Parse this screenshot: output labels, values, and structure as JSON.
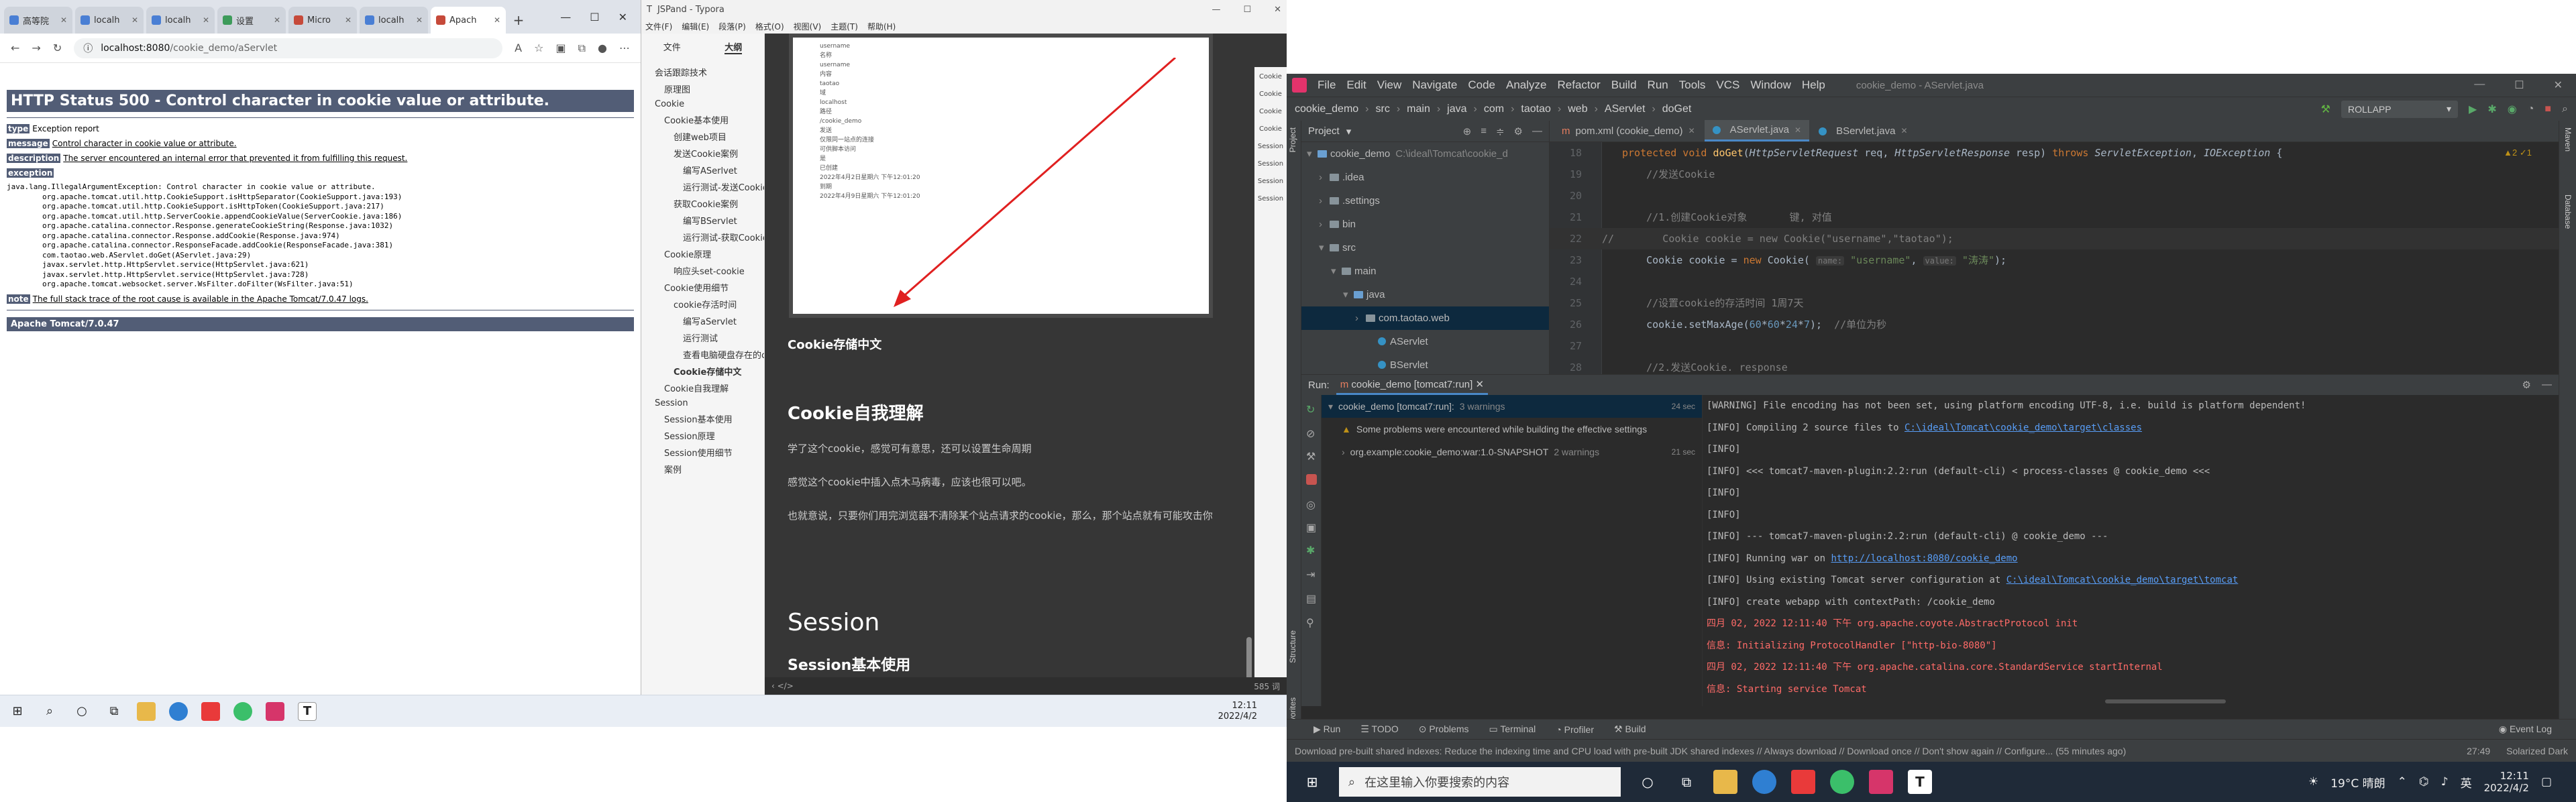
{
  "browser": {
    "tabs": [
      {
        "label": "高等院"
      },
      {
        "label": "localh"
      },
      {
        "label": "localh"
      },
      {
        "label": "设置"
      },
      {
        "label": "Micro"
      },
      {
        "label": "localh"
      },
      {
        "label": "Apach"
      }
    ],
    "url_host": "localhost:8080",
    "url_path": "/cookie_demo/aServlet",
    "page": {
      "title": "HTTP Status 500 - Control character in cookie value or attribute.",
      "type_label": "type",
      "type_value": "Exception report",
      "message_label": "message",
      "message_value": "Control character in cookie value or attribute.",
      "description_label": "description",
      "description_value": "The server encountered an internal error that prevented it from fulfilling this request.",
      "exception_label": "exception",
      "stacktrace": "java.lang.IllegalArgumentException: Control character in cookie value or attribute.\n\torg.apache.tomcat.util.http.CookieSupport.isHttpSeparator(CookieSupport.java:193)\n\torg.apache.tomcat.util.http.CookieSupport.isHttpToken(CookieSupport.java:217)\n\torg.apache.tomcat.util.http.ServerCookie.appendCookieValue(ServerCookie.java:186)\n\torg.apache.catalina.connector.Response.generateCookieString(Response.java:1032)\n\torg.apache.catalina.connector.Response.addCookie(Response.java:974)\n\torg.apache.catalina.connector.ResponseFacade.addCookie(ResponseFacade.java:381)\n\tcom.taotao.web.AServlet.doGet(AServlet.java:29)\n\tjavax.servlet.http.HttpServlet.service(HttpServlet.java:621)\n\tjavax.servlet.http.HttpServlet.service(HttpServlet.java:728)\n\torg.apache.tomcat.websocket.server.WsFilter.doFilter(WsFilter.java:51)",
      "note_label": "note",
      "note_value": "The full stack trace of the root cause is available in the Apache Tomcat/7.0.47 logs.",
      "footer": "Apache Tomcat/7.0.47"
    }
  },
  "typora": {
    "window_title": "JSPand - Typora",
    "menu": [
      "文件(F)",
      "编辑(E)",
      "段落(P)",
      "格式(O)",
      "视图(V)",
      "主题(T)",
      "帮助(H)"
    ],
    "sidebar_tabs": [
      "文件",
      "大纲"
    ],
    "outline": [
      {
        "text": "会话跟踪技术",
        "level": 1
      },
      {
        "text": "原理图",
        "level": 2
      },
      {
        "text": "Cookie",
        "level": 1
      },
      {
        "text": "Cookie基本使用",
        "level": 2
      },
      {
        "text": "创建web项目",
        "level": 3
      },
      {
        "text": "发送Cookie案例",
        "level": 3
      },
      {
        "text": "编写ASerlvet",
        "level": 4
      },
      {
        "text": "运行测试-发送Cookie",
        "level": 4
      },
      {
        "text": "获取Cookie案例",
        "level": 3
      },
      {
        "text": "编写BServlet",
        "level": 4
      },
      {
        "text": "运行测试-获取Cookie",
        "level": 4
      },
      {
        "text": "Cookie原理",
        "level": 2
      },
      {
        "text": "响应头set-cookie",
        "level": 3
      },
      {
        "text": "Cookie使用细节",
        "level": 2
      },
      {
        "text": "cookie存活时间",
        "level": 3
      },
      {
        "text": "编写aServlet",
        "level": 4
      },
      {
        "text": "运行测试",
        "level": 4
      },
      {
        "text": "查看电脑硬盘存在的cookie",
        "level": 4
      },
      {
        "text": "Cookie存储中文",
        "level": 3,
        "current": true
      },
      {
        "text": "Cookie自我理解",
        "level": 2
      },
      {
        "text": "Session",
        "level": 1
      },
      {
        "text": "Session基本使用",
        "level": 2
      },
      {
        "text": "Session原理",
        "level": 2
      },
      {
        "text": "Session使用细节",
        "level": 2
      },
      {
        "text": "案例",
        "level": 2
      }
    ],
    "image_form": [
      "username",
      "名称",
      "username",
      "内容",
      "taotao",
      "域",
      "localhost",
      "路径",
      "/cookie_demo",
      "发送",
      "仅限同一站点的连接",
      "可供脚本访问",
      "是",
      "已创建",
      "2022年4月2日星期六 下午12:01:20",
      "到期",
      "2022年4月9日星期六 下午12:01:20"
    ],
    "heading_cookie_cn": "Cookie存储中文",
    "heading_self": "Cookie自我理解",
    "para1": "学了这个cookie，感觉可有意思，还可以设置生命周期",
    "para2": "感觉这个cookie中插入点木马病毒，应该也很可以吧。",
    "para3": "也就意说，只要你们用完浏览器不清除某个站点请求的cookie，那么，那个站点就有可能攻击你",
    "heading_session": "Session",
    "heading_session_basic": "Session基本使用",
    "status_left": "‹  </>",
    "word_count": "585 词",
    "right_panel": [
      "Cookie",
      "Cookie",
      "Cookie",
      "Cookie",
      "Session",
      "Session",
      "Session",
      "Session"
    ]
  },
  "taskbar_left": {
    "time": "12:11",
    "date": "2022/4/2"
  },
  "idea": {
    "menu": [
      "File",
      "Edit",
      "View",
      "Navigate",
      "Code",
      "Analyze",
      "Refactor",
      "Build",
      "Run",
      "Tools",
      "VCS",
      "Window",
      "Help"
    ],
    "window_title": "cookie_demo - AServlet.java",
    "breadcrumb": [
      "cookie_demo",
      "src",
      "main",
      "java",
      "com",
      "taotao",
      "web",
      "AServlet",
      "doGet"
    ],
    "run_config": "ROLLAPP",
    "project_label": "Project",
    "tree": [
      {
        "text": "cookie_demo",
        "path": "C:\\ideal\\Tomcat\\cookie_d",
        "indent": 0,
        "kind": "folder-blue"
      },
      {
        "text": ".idea",
        "indent": 1,
        "kind": "folder"
      },
      {
        "text": ".settings",
        "indent": 1,
        "kind": "folder"
      },
      {
        "text": "bin",
        "indent": 1,
        "kind": "folder"
      },
      {
        "text": "src",
        "indent": 1,
        "kind": "folder"
      },
      {
        "text": "main",
        "indent": 2,
        "kind": "folder"
      },
      {
        "text": "java",
        "indent": 3,
        "kind": "folder-blue"
      },
      {
        "text": "com.taotao.web",
        "indent": 4,
        "kind": "folder",
        "selected": true
      },
      {
        "text": "AServlet",
        "indent": 5,
        "kind": "class"
      },
      {
        "text": "BServlet",
        "indent": 5,
        "kind": "class"
      }
    ],
    "editor_tabs": [
      "pom.xml (cookie_demo)",
      "AServlet.java",
      "BServlet.java"
    ],
    "warnings": "▲2 ✓1",
    "code_lines": [
      "18",
      "19",
      "20",
      "21",
      "22",
      "23",
      "24",
      "25",
      "26",
      "27",
      "28"
    ],
    "run": {
      "label": "Run:",
      "tab": "cookie_demo [tomcat7:run]",
      "tree": [
        {
          "text": "cookie_demo [tomcat7:run]:",
          "extra": "3 warnings",
          "time": "24 sec",
          "selected": true
        },
        {
          "text": "Some problems were encountered while building the effective settings",
          "extra": "",
          "time": ""
        },
        {
          "text": "org.example:cookie_demo:war:1.0-SNAPSHOT",
          "extra": "2 warnings",
          "time": "21 sec"
        }
      ],
      "console": [
        {
          "text": "[WARNING] File encoding has not been set, using platform encoding UTF-8, i.e. build is platform dependent!",
          "red": false
        },
        {
          "text": "[INFO] Compiling 2 source files to ",
          "link": "C:\\ideal\\Tomcat\\cookie_demo\\target\\classes",
          "red": false
        },
        {
          "text": "[INFO]",
          "red": false
        },
        {
          "text": "[INFO] <<< tomcat7-maven-plugin:2.2:run (default-cli) < process-classes @ cookie_demo <<<",
          "red": false
        },
        {
          "text": "[INFO]",
          "red": false
        },
        {
          "text": "[INFO]",
          "red": false
        },
        {
          "text": "[INFO] --- tomcat7-maven-plugin:2.2:run (default-cli) @ cookie_demo ---",
          "red": false
        },
        {
          "text": "[INFO] Running war on ",
          "link": "http://localhost:8080/cookie_demo",
          "red": false
        },
        {
          "text": "[INFO] Using existing Tomcat server configuration at ",
          "link": "C:\\ideal\\Tomcat\\cookie_demo\\target\\tomcat",
          "red": false
        },
        {
          "text": "[INFO] create webapp with contextPath: /cookie_demo",
          "red": false
        },
        {
          "text": "四月 02, 2022 12:11:40 下午 org.apache.coyote.AbstractProtocol init",
          "red": true
        },
        {
          "text": "信息: Initializing ProtocolHandler [\"http-bio-8080\"]",
          "red": true
        },
        {
          "text": "四月 02, 2022 12:11:40 下午 org.apache.catalina.core.StandardService startInternal",
          "red": true
        },
        {
          "text": "信息: Starting service Tomcat",
          "red": true
        }
      ]
    },
    "toolwindows": [
      "Run",
      "TODO",
      "Problems",
      "Terminal",
      "Profiler",
      "Build"
    ],
    "event_log": "Event Log",
    "status_msg": "Download pre-built shared indexes: Reduce the indexing time and CPU load with pre-built JDK shared indexes // Always download // Download once // Don't show again // Configure... (55 minutes ago)",
    "status_pos": "27:49",
    "status_theme": "Solarized Dark",
    "left_strip": [
      "Project",
      "Structure",
      "Favorites"
    ],
    "right_strip": [
      "Maven",
      "Database"
    ]
  },
  "taskbar_right": {
    "search_placeholder": "在这里输入你要搜索的内容",
    "weather": "19°C 晴朗",
    "time": "12:11",
    "date": "2022/4/2"
  }
}
